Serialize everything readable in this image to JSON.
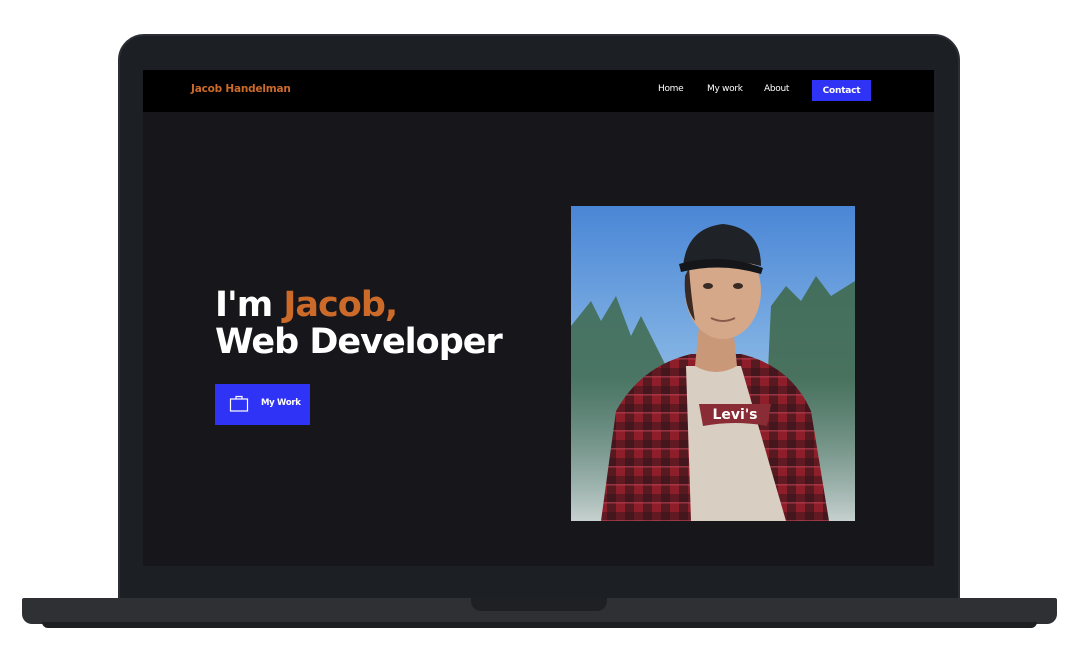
{
  "site": {
    "brand": "Jacob Handelman",
    "nav": {
      "home": "Home",
      "my_work": "My work",
      "about": "About",
      "contact": "Contact"
    },
    "hero": {
      "prefix": "I'm ",
      "name": "Jacob,",
      "role": "Web Developer",
      "cta_label": "My Work",
      "cta_icon": "briefcase-icon"
    },
    "portrait_shirt_logo": "Levi's"
  },
  "colors": {
    "accent": "#cc6a2a",
    "button": "#2f33f5",
    "background": "#17161b",
    "navbar": "#000000"
  }
}
